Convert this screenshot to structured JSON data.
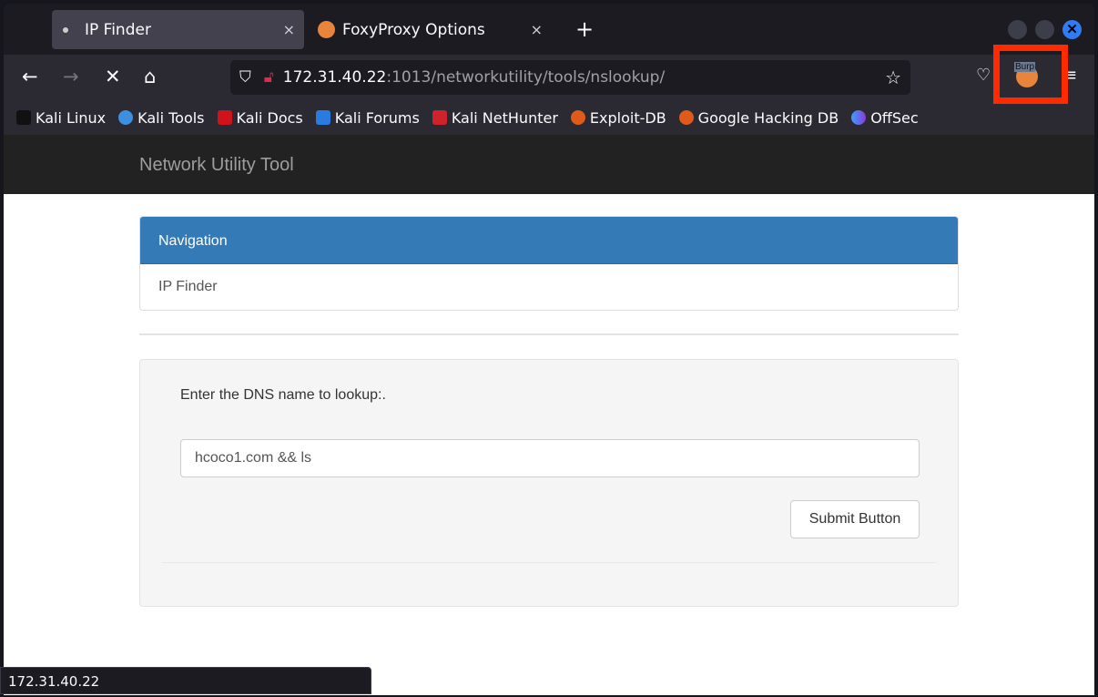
{
  "browser": {
    "tabs": [
      {
        "label": "IP Finder",
        "active": true
      },
      {
        "label": "FoxyProxy Options",
        "active": false
      }
    ],
    "new_tab": "+",
    "close_tab": "×",
    "url_host": "172.31.40.22",
    "url_rest": ":1013/networkutility/tools/nslookup/",
    "extension_label": "Burp",
    "bookmarks": [
      "Kali Linux",
      "Kali Tools",
      "Kali Docs",
      "Kali Forums",
      "Kali NetHunter",
      "Exploit-DB",
      "Google Hacking DB",
      "OffSec"
    ],
    "status_url": "172.31.40.22",
    "highlight_color": "#ff2a00"
  },
  "app": {
    "brand": "Network Utility Tool",
    "nav_header": "Navigation",
    "nav_item": "IP Finder",
    "form_label": "Enter the DNS name to lookup:.",
    "input_value": "hcoco1.com && ls",
    "submit_label": "Submit Button",
    "accent": "#337ab7"
  }
}
